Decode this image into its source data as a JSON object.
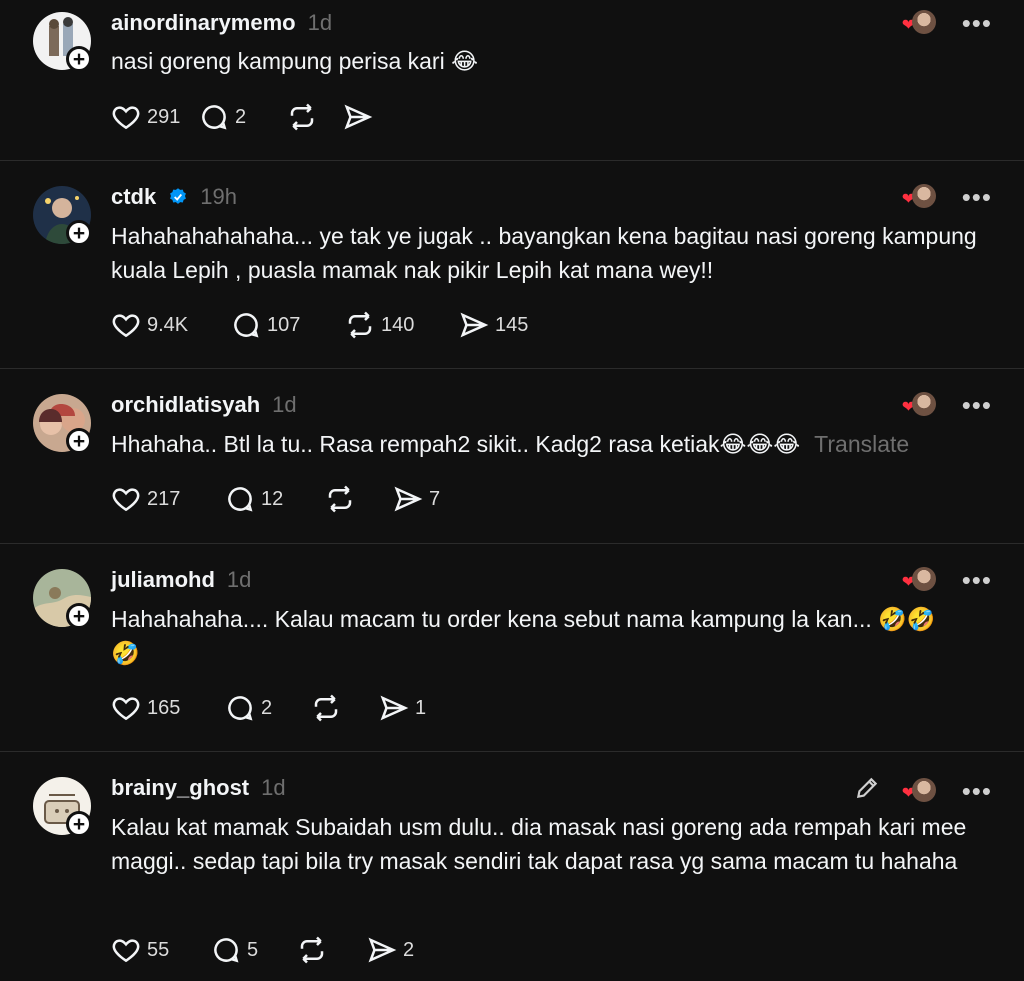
{
  "posts": [
    {
      "username": "ainordinarymemo",
      "time": "1d",
      "text": "nasi goreng kampung perisa kari 😂",
      "likes": "291",
      "replies": "2",
      "reposts": "",
      "shares": ""
    },
    {
      "username": "ctdk",
      "time": "19h",
      "text": "Hahahahahahaha... ye tak ye jugak .. bayangkan kena bagitau nasi goreng kampung kuala Lepih , puasla mamak nak pikir Lepih kat mana wey!!",
      "likes": "9.4K",
      "replies": "107",
      "reposts": "140",
      "shares": "145"
    },
    {
      "username": "orchidlatisyah",
      "time": "1d",
      "text": "Hhahaha.. Btl la tu.. Rasa rempah2 sikit.. Kadg2 rasa ketiak😂😂😂",
      "translate": "Translate",
      "likes": "217",
      "replies": "12",
      "reposts": "",
      "shares": "7"
    },
    {
      "username": "juliamohd",
      "time": "1d",
      "text": "Hahahahaha.... Kalau macam tu order kena sebut nama kampung la kan... 🤣🤣🤣",
      "likes": "165",
      "replies": "2",
      "reposts": "",
      "shares": "1"
    },
    {
      "username": "brainy_ghost",
      "time": "1d",
      "text": "Kalau kat mamak Subaidah usm dulu.. dia masak nasi goreng ada rempah kari mee maggi.. sedap tapi bila try masak sendiri tak dapat rasa yg sama macam tu hahaha",
      "likes": "55",
      "replies": "5",
      "reposts": "",
      "shares": "2"
    }
  ],
  "icons": {
    "like": "heart-icon",
    "reply": "comment-icon",
    "repost": "repost-icon",
    "share": "send-icon",
    "more": "more-icon",
    "edit": "pencil-icon",
    "verified": "verified-badge-icon"
  },
  "colors": {
    "background": "#101010",
    "text": "#f3f5f7",
    "muted": "#6f6f6f",
    "heart": "#ff3040",
    "verified": "#0095f6"
  },
  "more_glyph": "•••",
  "plus_glyph": "+"
}
